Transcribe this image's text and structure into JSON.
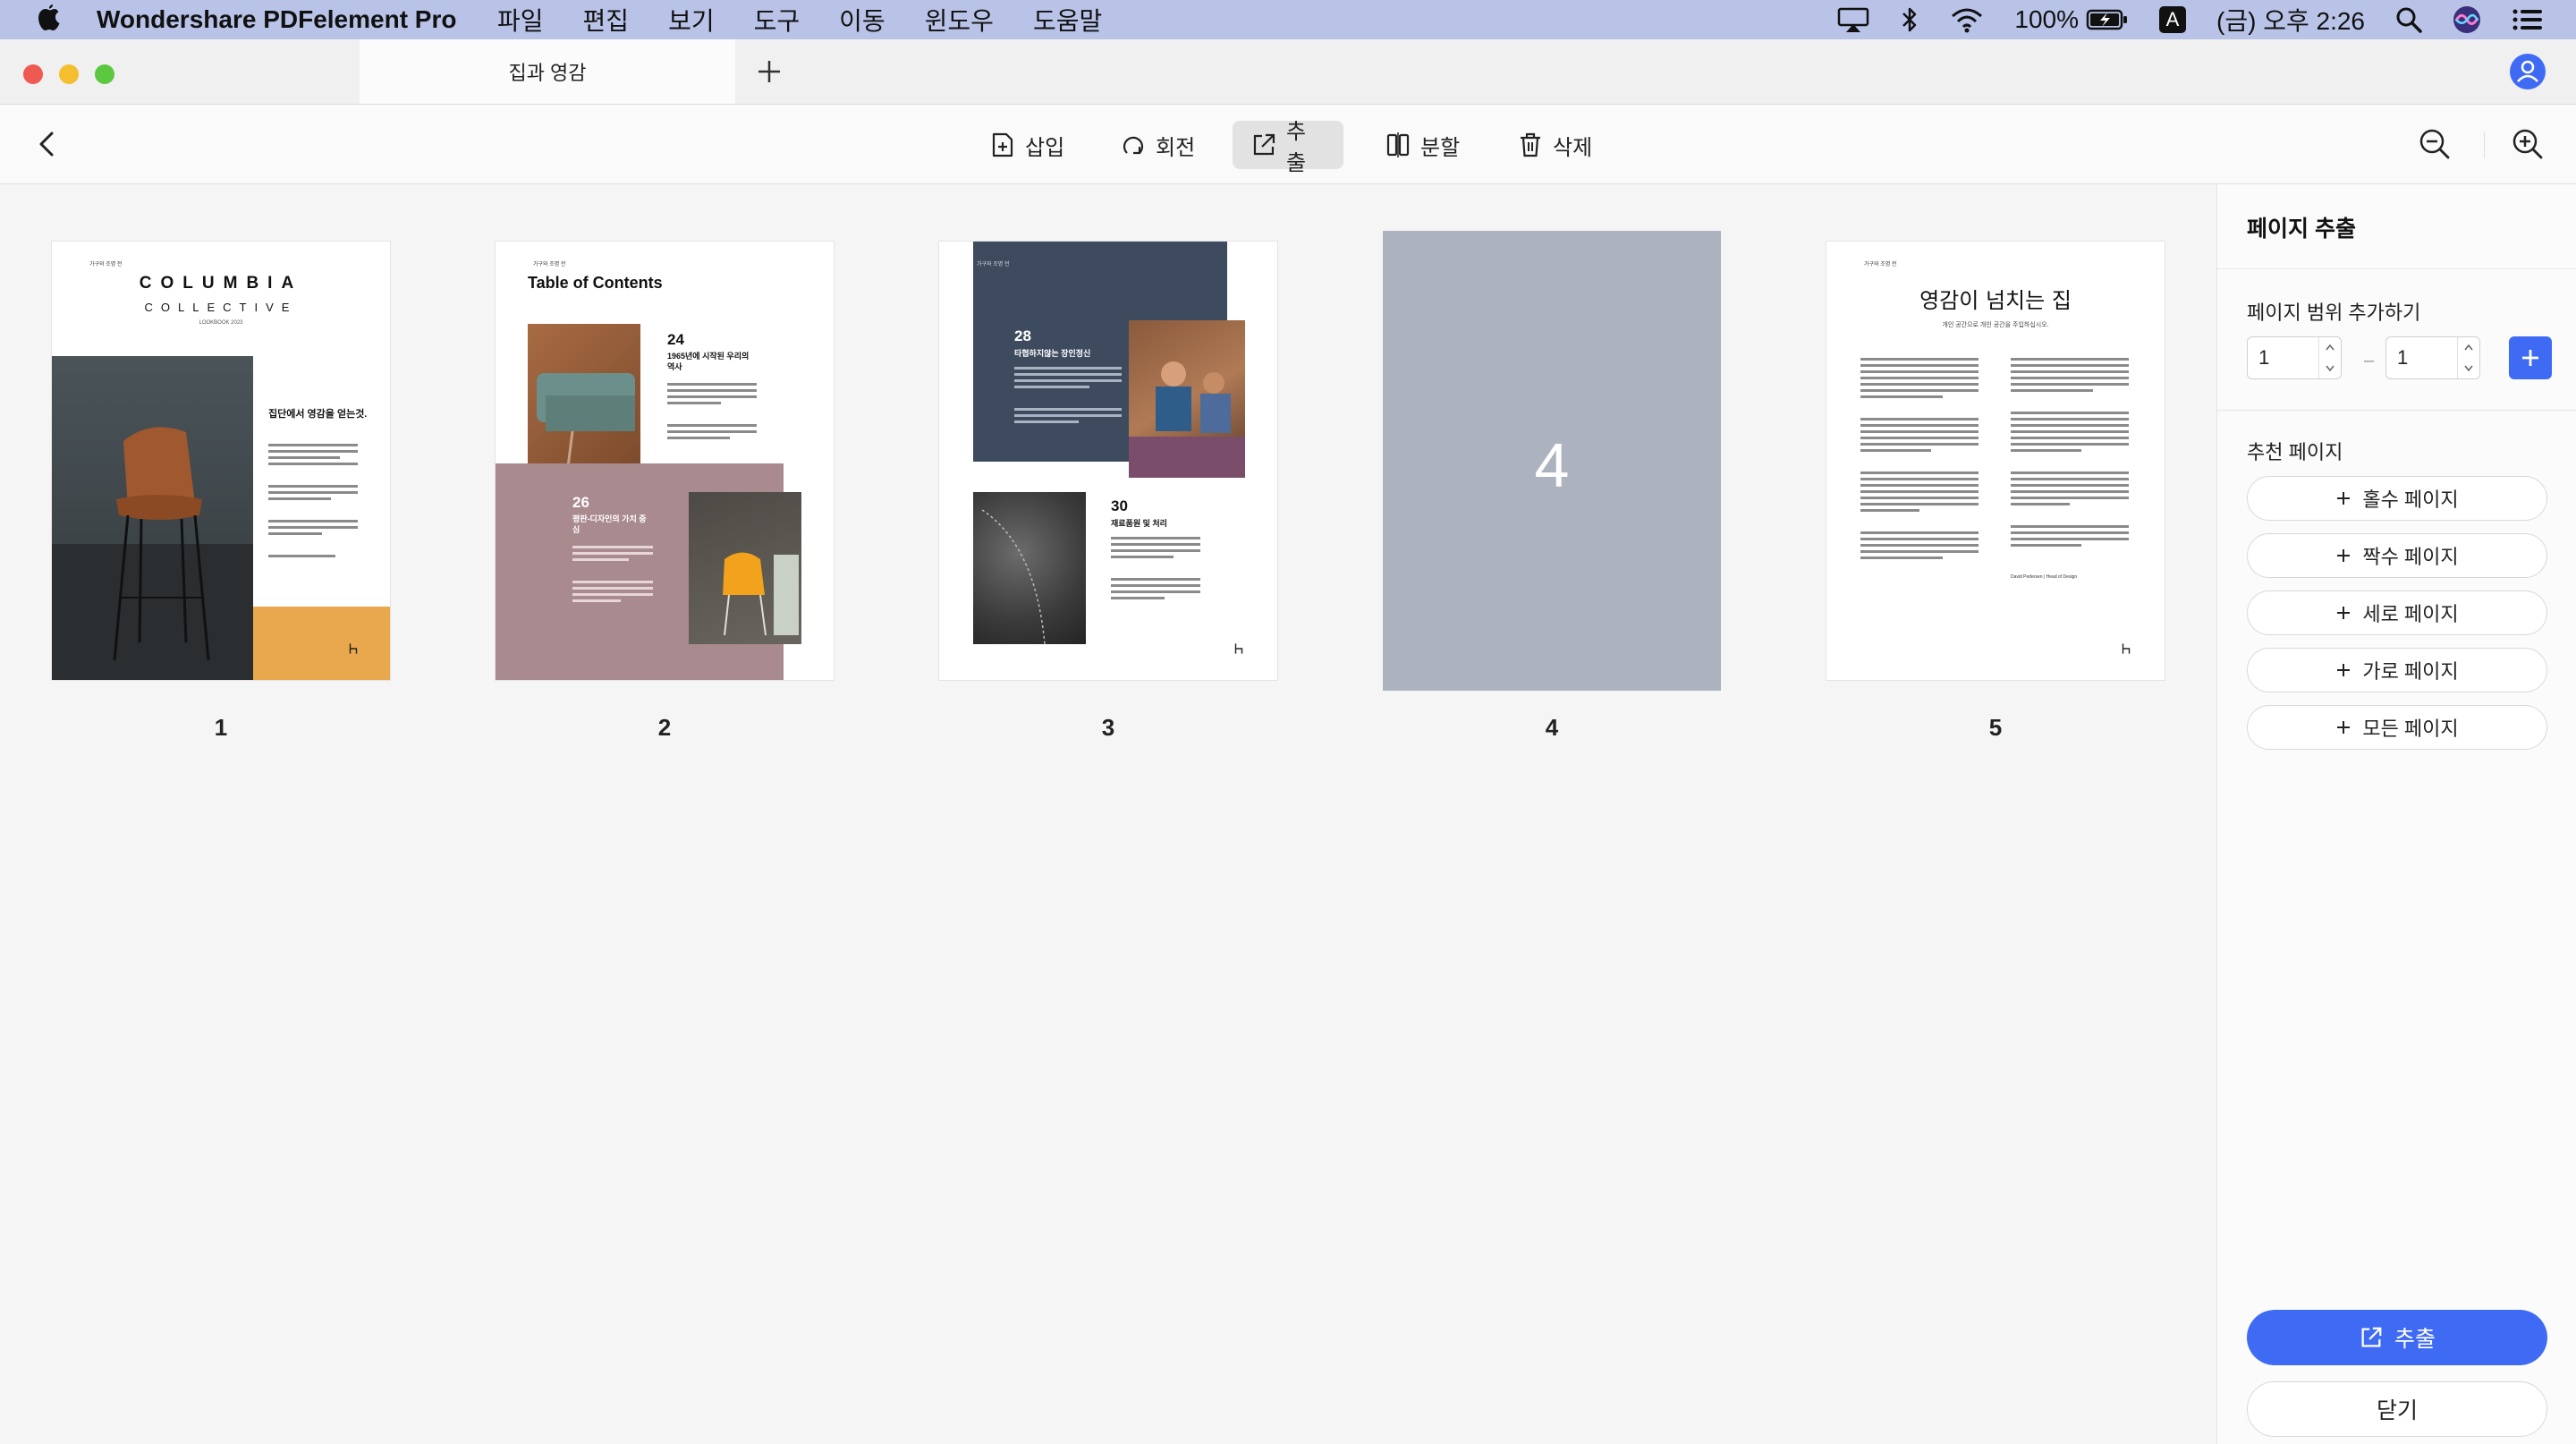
{
  "menubar": {
    "app_name": "Wondershare PDFelement Pro",
    "menus": [
      "파일",
      "편집",
      "보기",
      "도구",
      "이동",
      "윈도우",
      "도움말"
    ],
    "battery": "100%",
    "input_source": "A",
    "clock": "(금) 오후 2:26"
  },
  "tabs": {
    "active": "집과 영감"
  },
  "toolbar": {
    "insert": "삽입",
    "rotate": "회전",
    "extract": "추출",
    "split": "분할",
    "delete": "삭제"
  },
  "pages": [
    {
      "number": "1",
      "header": "가구와 조명 전",
      "brand": "COLUMBIA",
      "brand_sub": "COLLECTIVE",
      "edition": "LOOKBOOK 2023",
      "headline": "집단에서 영감을 얻는것."
    },
    {
      "number": "2",
      "header": "가구와 조명 전",
      "toc_title": "Table of Contents",
      "entry1_num": "24",
      "entry1_title": "1965년에 시작된 우리의 역사",
      "entry2_num": "26",
      "entry2_title": "평판-디자인의 가치 중심"
    },
    {
      "number": "3",
      "header": "가구와 조명 전",
      "sec1_num": "28",
      "sec1_title": "타협하지않는 장인정신",
      "sec2_num": "30",
      "sec2_title": "재료품원 및 처리"
    },
    {
      "number": "4",
      "label": "4"
    },
    {
      "number": "5",
      "header": "가구와 조명 전",
      "title": "영감이 넘치는 집",
      "subtitle": "개인 공간으로 개인 공간을 주입하십시오.",
      "signature": "David Pedersen | Head of Design"
    }
  ],
  "panel": {
    "title": "페이지 추출",
    "range_label": "페이지 범위 추가하기",
    "range_from": "1",
    "range_sep": "–",
    "range_to": "1",
    "recommended_label": "추천 페이지",
    "recommended": [
      "홀수 페이지",
      "짝수 페이지",
      "세로 페이지",
      "가로 페이지",
      "모든 페이지"
    ],
    "extract_button": "추출",
    "close_button": "닫기"
  },
  "colors": {
    "accent": "#3f6bf4",
    "menubar_bg": "#b9c3e8",
    "selected_page": "#adb2bf",
    "dusty_pink": "#a98a8f",
    "navy_block": "#3e4b5f",
    "orange_block": "#e9a84d"
  }
}
